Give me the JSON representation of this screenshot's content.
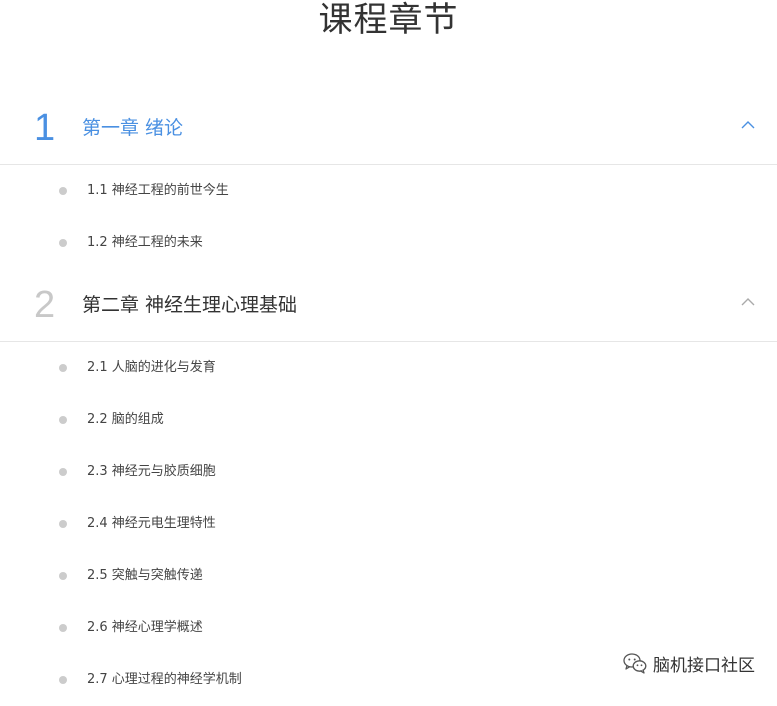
{
  "page": {
    "title": "课程章节"
  },
  "chapters": [
    {
      "number": "1",
      "title": "第一章 绪论",
      "expanded": true,
      "active": true,
      "lessons": [
        "1.1 神经工程的前世今生",
        "1.2 神经工程的未来"
      ]
    },
    {
      "number": "2",
      "title": "第二章 神经生理心理基础",
      "expanded": true,
      "active": false,
      "lessons": [
        "2.1 人脑的进化与发育",
        "2.2 脑的组成",
        "2.3 神经元与胶质细胞",
        "2.4 神经元电生理特性",
        "2.5 突触与突触传递",
        "2.6 神经心理学概述",
        "2.7 心理过程的神经学机制"
      ]
    }
  ],
  "watermark": {
    "text": "脑机接口社区",
    "icon": "wechat-icon"
  },
  "colors": {
    "accent": "#4a90e2",
    "number_inactive": "#c8c8c8",
    "bullet": "#cccccc",
    "divider": "#e6e6e6",
    "text": "#333333"
  }
}
